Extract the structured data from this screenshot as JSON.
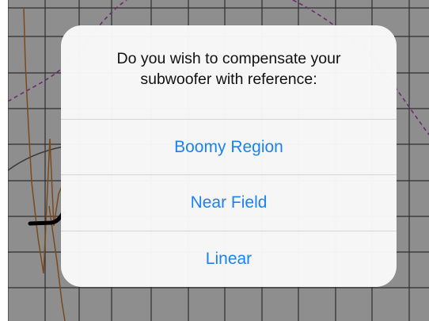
{
  "alert": {
    "message": "Do you wish to compensate your subwoofer with reference:",
    "actions": [
      {
        "label": "Boomy Region"
      },
      {
        "label": "Near Field"
      },
      {
        "label": "Linear"
      }
    ]
  },
  "colors": {
    "backdrop": "#8e8e8e",
    "grid": "#2e2e2e",
    "action_text": "#1a82f2",
    "dashed_curve": "#6e2a6e",
    "brown_curve": "#7a4a1e"
  }
}
